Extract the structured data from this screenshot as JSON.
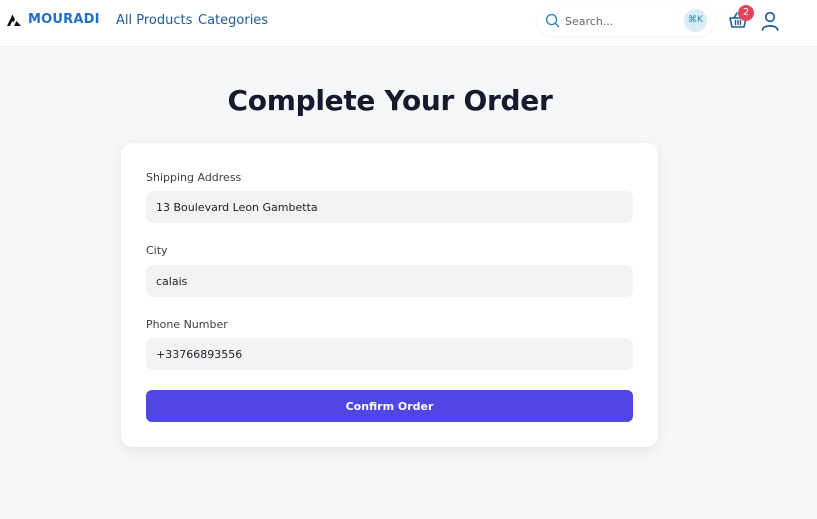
{
  "brand": {
    "name": "MOURADI",
    "color": "#1e6fc8"
  },
  "nav": {
    "links": [
      "All Products",
      "Categories"
    ]
  },
  "search": {
    "placeholder": "Search...",
    "shortcut": "⌘K"
  },
  "cart": {
    "count": "2",
    "icon": "basket-icon"
  },
  "user": {
    "icon": "user-icon"
  },
  "page": {
    "title": "Complete Your Order"
  },
  "form": {
    "fields": [
      {
        "label": "Shipping Address",
        "value": "13 Boulevard Leon Gambetta"
      },
      {
        "label": "City",
        "value": "calais"
      },
      {
        "label": "Phone Number",
        "value": "+33766893556"
      }
    ],
    "submit_label": "Confirm Order"
  },
  "colors": {
    "accent": "#4f46e5",
    "badge": "#e5425c",
    "nav_link": "#1b5c97",
    "background": "#f6f7f8"
  }
}
